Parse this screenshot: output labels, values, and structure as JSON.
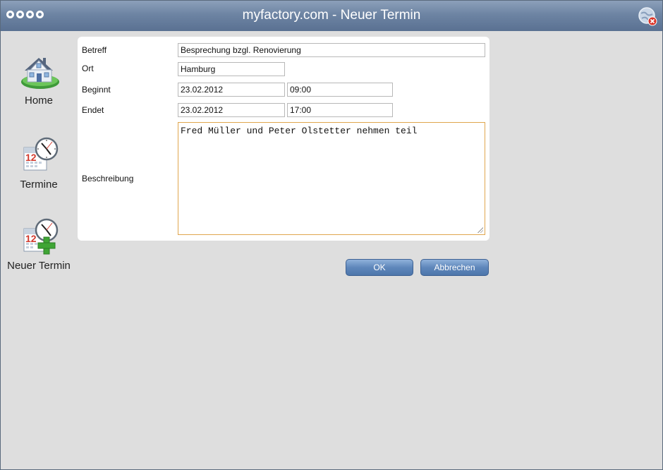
{
  "window": {
    "title": "myfactory.com - Neuer Termin"
  },
  "sidebar": {
    "items": [
      {
        "label": "Home",
        "icon": "house-icon"
      },
      {
        "label": "Termine",
        "icon": "calendar-clock-icon"
      },
      {
        "label": "Neuer Termin",
        "icon": "calendar-clock-add-icon"
      }
    ]
  },
  "form": {
    "betreff_label": "Betreff",
    "betreff_value": "Besprechung bzgl. Renovierung",
    "ort_label": "Ort",
    "ort_value": "Hamburg",
    "beginnt_label": "Beginnt",
    "beginnt_date": "23.02.2012",
    "beginnt_time": "09:00",
    "endet_label": "Endet",
    "endet_date": "23.02.2012",
    "endet_time": "17:00",
    "beschreibung_label": "Beschreibung",
    "beschreibung_value": "Fred Müller und Peter Olstetter nehmen teil"
  },
  "buttons": {
    "ok": "OK",
    "cancel": "Abbrechen"
  },
  "colors": {
    "titlebar": "#6d84a3",
    "button": "#5f87bb",
    "focus_border": "#e0a64d",
    "accent_green": "#3fa535"
  }
}
